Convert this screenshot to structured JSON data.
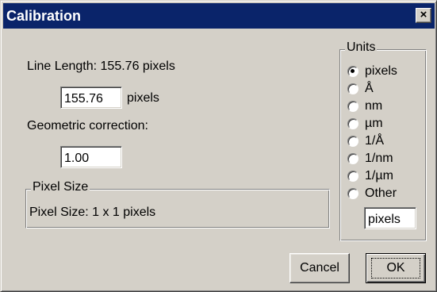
{
  "window": {
    "title": "Calibration",
    "close_label": "×"
  },
  "line_length": {
    "label": "Line Length: 155.76 pixels",
    "value": "155.76",
    "unit": "pixels"
  },
  "geometric_correction": {
    "label": "Geometric correction:",
    "value": "1.00"
  },
  "pixel_size": {
    "group_label": "Pixel Size",
    "text": "Pixel Size: 1 x 1 pixels"
  },
  "units": {
    "group_label": "Units",
    "options": [
      {
        "label": "pixels",
        "checked": true
      },
      {
        "label": "Å",
        "checked": false
      },
      {
        "label": "nm",
        "checked": false
      },
      {
        "label": "µm",
        "checked": false
      },
      {
        "label": "1/Å",
        "checked": false
      },
      {
        "label": "1/nm",
        "checked": false
      },
      {
        "label": "1/µm",
        "checked": false
      },
      {
        "label": "Other",
        "checked": false
      }
    ],
    "other_value": "pixels"
  },
  "buttons": {
    "cancel_label": "Cancel",
    "ok_label": "OK"
  }
}
